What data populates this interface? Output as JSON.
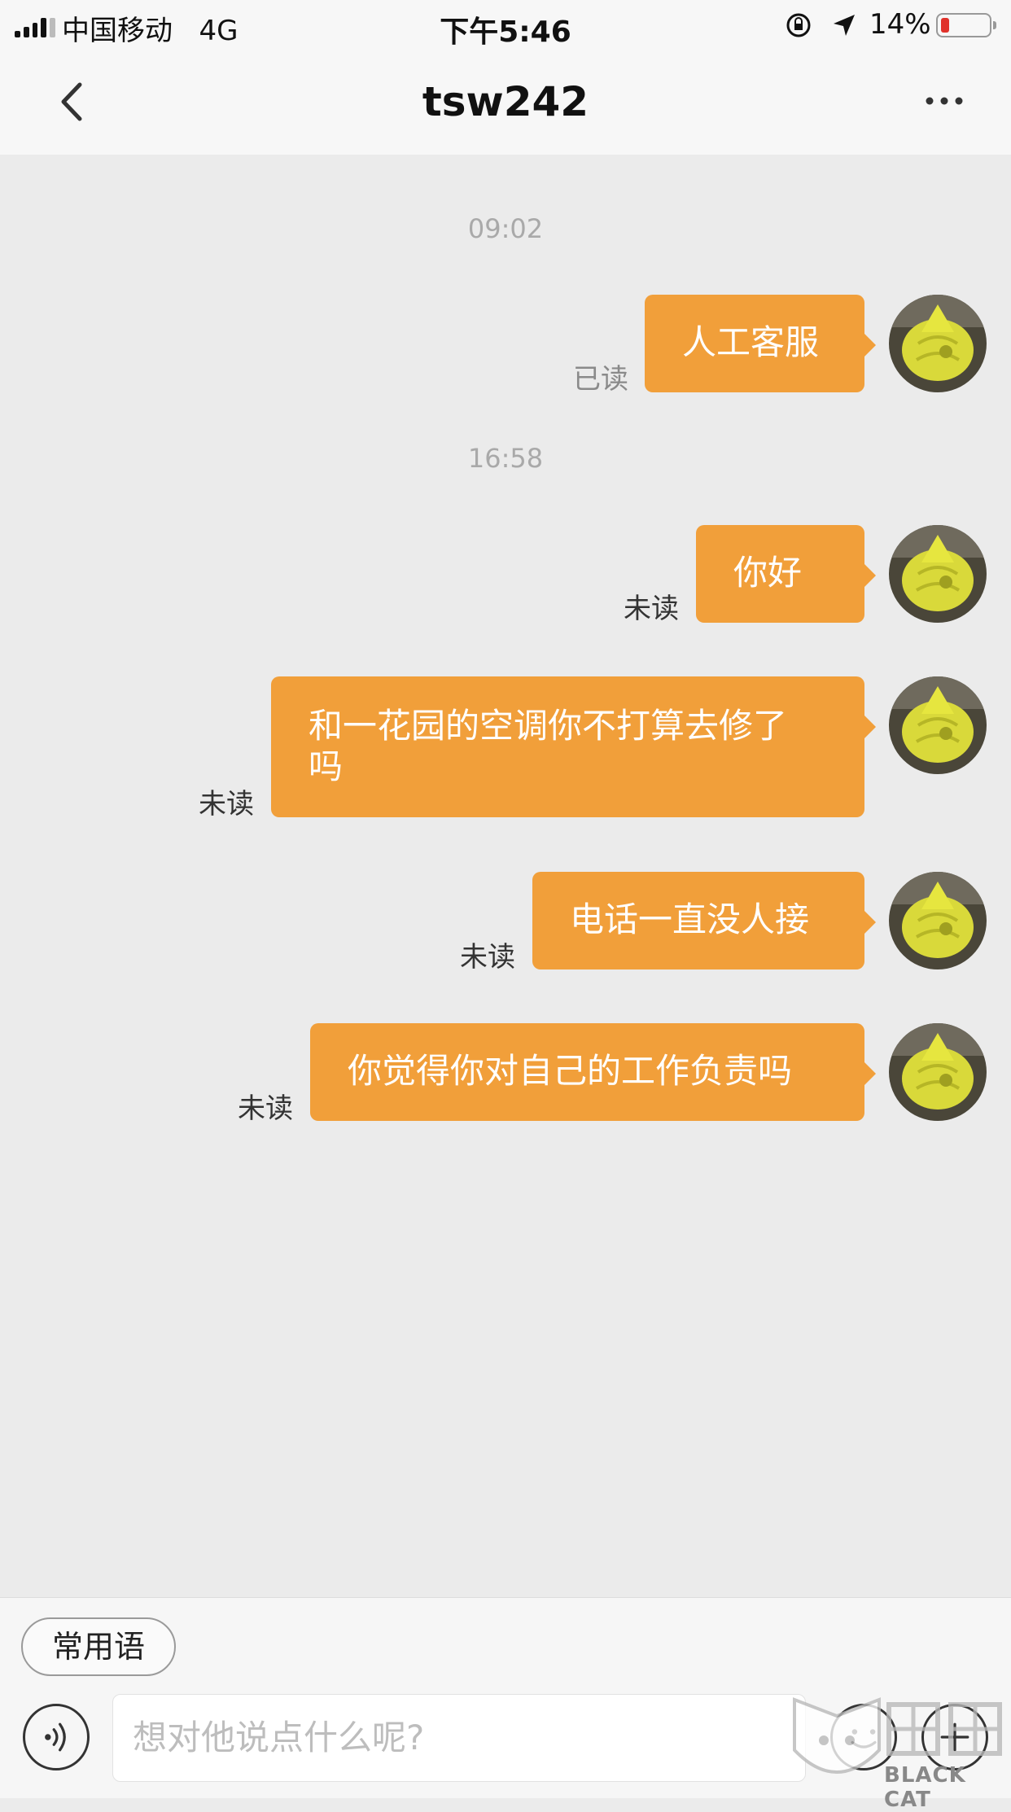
{
  "status_bar": {
    "carrier": "中国移动",
    "network": "4G",
    "time": "下午5:46",
    "battery_percent": "14%",
    "battery_level": 0.14,
    "icons": [
      "signal-icon",
      "orientation-lock-icon",
      "location-arrow-icon",
      "battery-icon"
    ]
  },
  "nav": {
    "title": "tsw242",
    "back_icon": "chevron-left-icon",
    "more_icon": "more-dots-icon"
  },
  "messages": {
    "ts1": "09:02",
    "ts2": "16:58",
    "m1": {
      "text": "人工客服",
      "status": "已读"
    },
    "m2": {
      "text": "你好",
      "status": "未读"
    },
    "m3": {
      "line1": "和一花园的空调你不打算去修了",
      "line2": "吗",
      "status": "未读"
    },
    "m4": {
      "text": "电话一直没人接",
      "status": "未读"
    },
    "m5": {
      "text": "你觉得你对自己的工作负责吗",
      "status": "未读"
    }
  },
  "composer": {
    "quick_phrases_label": "常用语",
    "input_placeholder": "想对他说点什么呢?",
    "voice_icon": "voice-icon",
    "emoji_icon": "emoji-icon",
    "plus_icon": "plus-icon"
  },
  "watermark": {
    "text": "BLACK CAT"
  },
  "colors": {
    "bubble": "#f19f3a",
    "background": "#ebebeb",
    "bar": "#f7f7f7"
  }
}
